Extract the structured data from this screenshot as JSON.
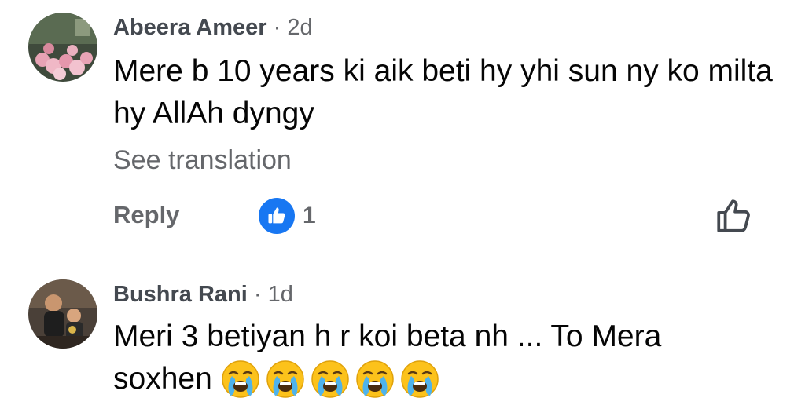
{
  "comments": [
    {
      "author": "Abeera Ameer",
      "separator": "·",
      "time": "2d",
      "text": "Mere b 10 years ki aik beti hy yhi sun ny ko milta hy AllAh dyngy",
      "see_translation": "See translation",
      "reply_label": "Reply",
      "reaction_count": "1",
      "reaction_icon": "thumbs-up-icon",
      "avatar_desc": "avatar"
    },
    {
      "author": "Bushra Rani",
      "separator": "·",
      "time": "1d",
      "text_line1": "Meri 3 betiyan h r koi beta nh ... To Mera",
      "text_line2": "soxhen",
      "emoji": [
        "loudly-crying-face",
        "loudly-crying-face",
        "loudly-crying-face",
        "loudly-crying-face",
        "loudly-crying-face"
      ]
    }
  ],
  "colors": {
    "accent": "#1877f2",
    "secondary_text": "#65676b",
    "primary_text": "#050505"
  }
}
